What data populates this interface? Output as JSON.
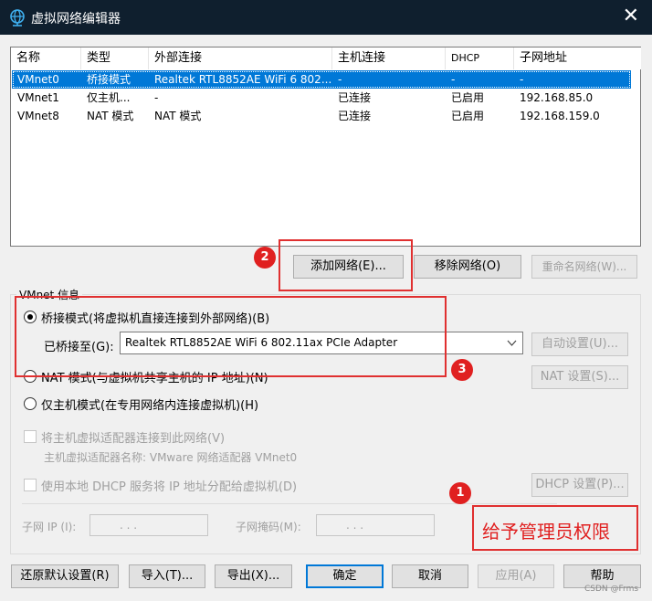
{
  "window": {
    "title": "虚拟网络编辑器",
    "close_glyph": "✕"
  },
  "table": {
    "headers": [
      "名称",
      "类型",
      "外部连接",
      "主机连接",
      "DHCP",
      "子网地址"
    ],
    "rows": [
      [
        "VMnet0",
        "桥接模式",
        "Realtek RTL8852AE WiFi 6 802....",
        "-",
        "-",
        "-"
      ],
      [
        "VMnet1",
        "仅主机...",
        "-",
        "已连接",
        "已启用",
        "192.168.85.0"
      ],
      [
        "VMnet8",
        "NAT 模式",
        "NAT 模式",
        "已连接",
        "已启用",
        "192.168.159.0"
      ]
    ],
    "selected_row": 0
  },
  "net_buttons": {
    "add": "添加网络(E)...",
    "remove": "移除网络(O)",
    "rename": "重命名网络(W)..."
  },
  "vmnet_info": {
    "group_title": "VMnet 信息",
    "bridged_label": "桥接模式(将虚拟机直接连接到外部网络)(B)",
    "bridged_to_label": "已桥接至(G):",
    "bridged_adapter": "Realtek RTL8852AE WiFi 6 802.11ax PCIe Adapter",
    "auto_button": "自动设置(U)...",
    "nat_label": "NAT 模式(与虚拟机共享主机的 IP 地址)(N)",
    "nat_button": "NAT 设置(S)...",
    "hostonly_label": "仅主机模式(在专用网络内连接虚拟机)(H)",
    "connect_adapter_label": "将主机虚拟适配器连接到此网络(V)",
    "adapter_name_label": "主机虚拟适配器名称: VMware 网络适配器 VMnet0",
    "dhcp_label": "使用本地 DHCP 服务将 IP 地址分配给虚拟机(D)",
    "dhcp_button": "DHCP 设置(P)...",
    "subnet_ip_label": "子网 IP (I):",
    "subnet_ip_value": ".   .   .",
    "subnet_mask_label": "子网掩码(M):",
    "subnet_mask_value": ".   .   ."
  },
  "annotations": {
    "badge1": "1",
    "badge2": "2",
    "badge3": "3",
    "admin_text": "给予管理员权限",
    "red_color": "#e03030"
  },
  "bottom_buttons": {
    "restore": "还原默认设置(R)",
    "import": "导入(T)...",
    "export": "导出(X)...",
    "ok": "确定",
    "cancel": "取消",
    "apply": "应用(A)",
    "help": "帮助"
  },
  "watermark": "CSDN @Frms"
}
